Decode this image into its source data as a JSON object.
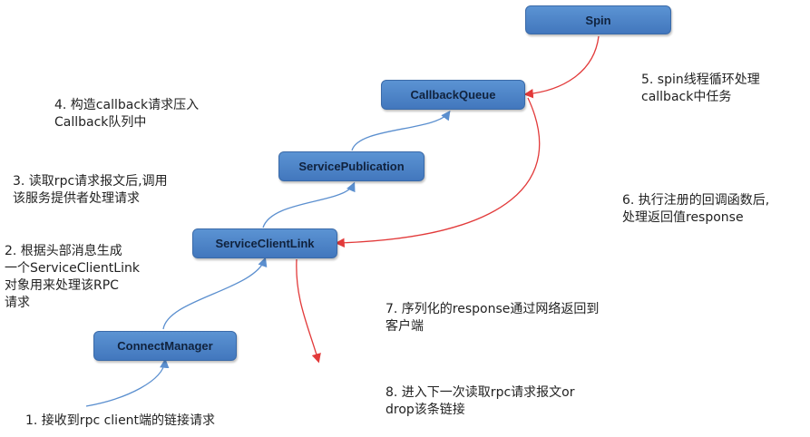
{
  "nodes": {
    "spin": "Spin",
    "callback_queue": "CallbackQueue",
    "service_publication": "ServicePublication",
    "service_client_link": "ServiceClientLink",
    "connect_manager": "ConnectManager"
  },
  "notes": {
    "n1": [
      "1. 接收到rpc client端的链接请求"
    ],
    "n2": [
      "2. 根据头部消息生成",
      "一个ServiceClientLink",
      "对象用来处理该RPC",
      "请求"
    ],
    "n3": [
      "3. 读取rpc请求报文后,调用",
      "该服务提供者处理请求"
    ],
    "n4": [
      "4. 构造callback请求压入",
      "Callback队列中"
    ],
    "n5": [
      "5. spin线程循环处理",
      "callback中任务"
    ],
    "n6": [
      "6. 执行注册的回调函数后,",
      "处理返回值response"
    ],
    "n7": [
      "7. 序列化的response通过网络返回到",
      "客户端"
    ],
    "n8": [
      "8. 进入下一次读取rpc请求报文or",
      "drop该条链接"
    ]
  },
  "colors": {
    "blue_arrow": "#5b8fcf",
    "red_arrow": "#e23a3a",
    "node_fill": "#4f86c9"
  }
}
